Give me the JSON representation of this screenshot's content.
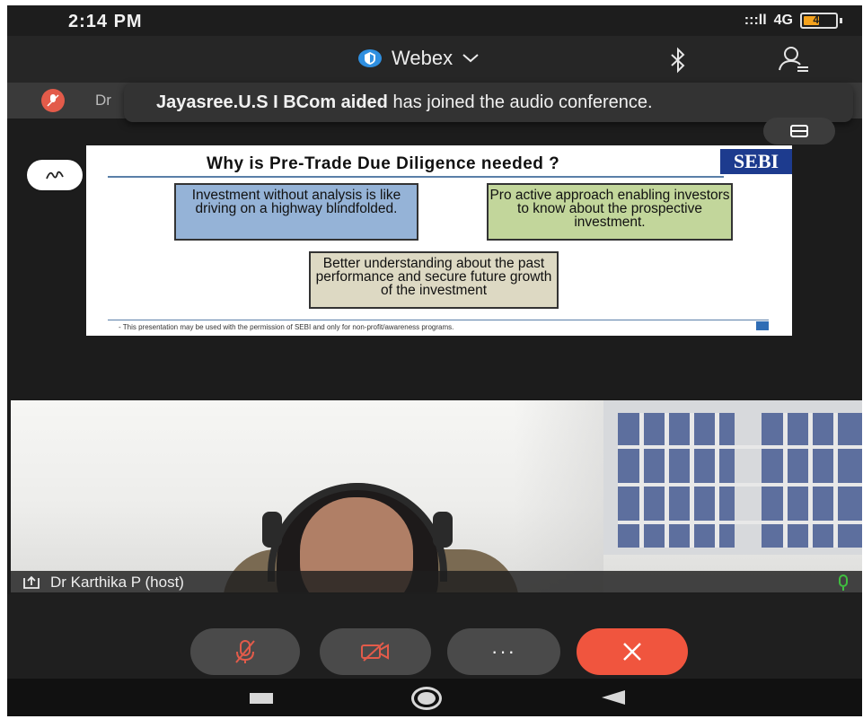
{
  "status_bar": {
    "time": "2:14 PM",
    "signal": ":::ll",
    "network": "4G",
    "battery": "44",
    "icons": [
      "signal-icon",
      "data-arrows-icon",
      "battery-icon"
    ]
  },
  "header": {
    "app_name": "Webex",
    "icons": [
      "shield-icon",
      "chevron-down-icon",
      "bluetooth-icon",
      "participants-icon"
    ]
  },
  "notification": {
    "strip_label": "Dr",
    "toast_name": "Jayasree.U.S I BCom aided",
    "toast_message": " has joined the audio conference."
  },
  "slide": {
    "title": "Why is Pre-Trade Due Diligence needed ?",
    "logo_text": "SEBI",
    "boxes": [
      {
        "text": "Investment without analysis is like driving on a highway blindfolded."
      },
      {
        "text": "Pro active approach enabling investors to know about the prospective investment."
      },
      {
        "text": "Better understanding about the past performance and secure future growth of the investment"
      }
    ],
    "footer": "- This presentation may be used with the permission of SEBI and only for non-profit/awareness programs."
  },
  "video": {
    "participant_label": "Dr Karthika P (host)"
  },
  "controls": {
    "more_label": "···",
    "icons": [
      "mic-muted-icon",
      "video-off-icon",
      "more-icon",
      "end-call-icon"
    ]
  },
  "colors": {
    "end_call": "#f0553e",
    "mute_icon": "#e35b4a",
    "slide_blue": "#95b3d7",
    "slide_green": "#c2d69b",
    "slide_tan": "#ddd9c3",
    "battery": "#f4a21d",
    "mic_active": "#3fbf3f"
  }
}
